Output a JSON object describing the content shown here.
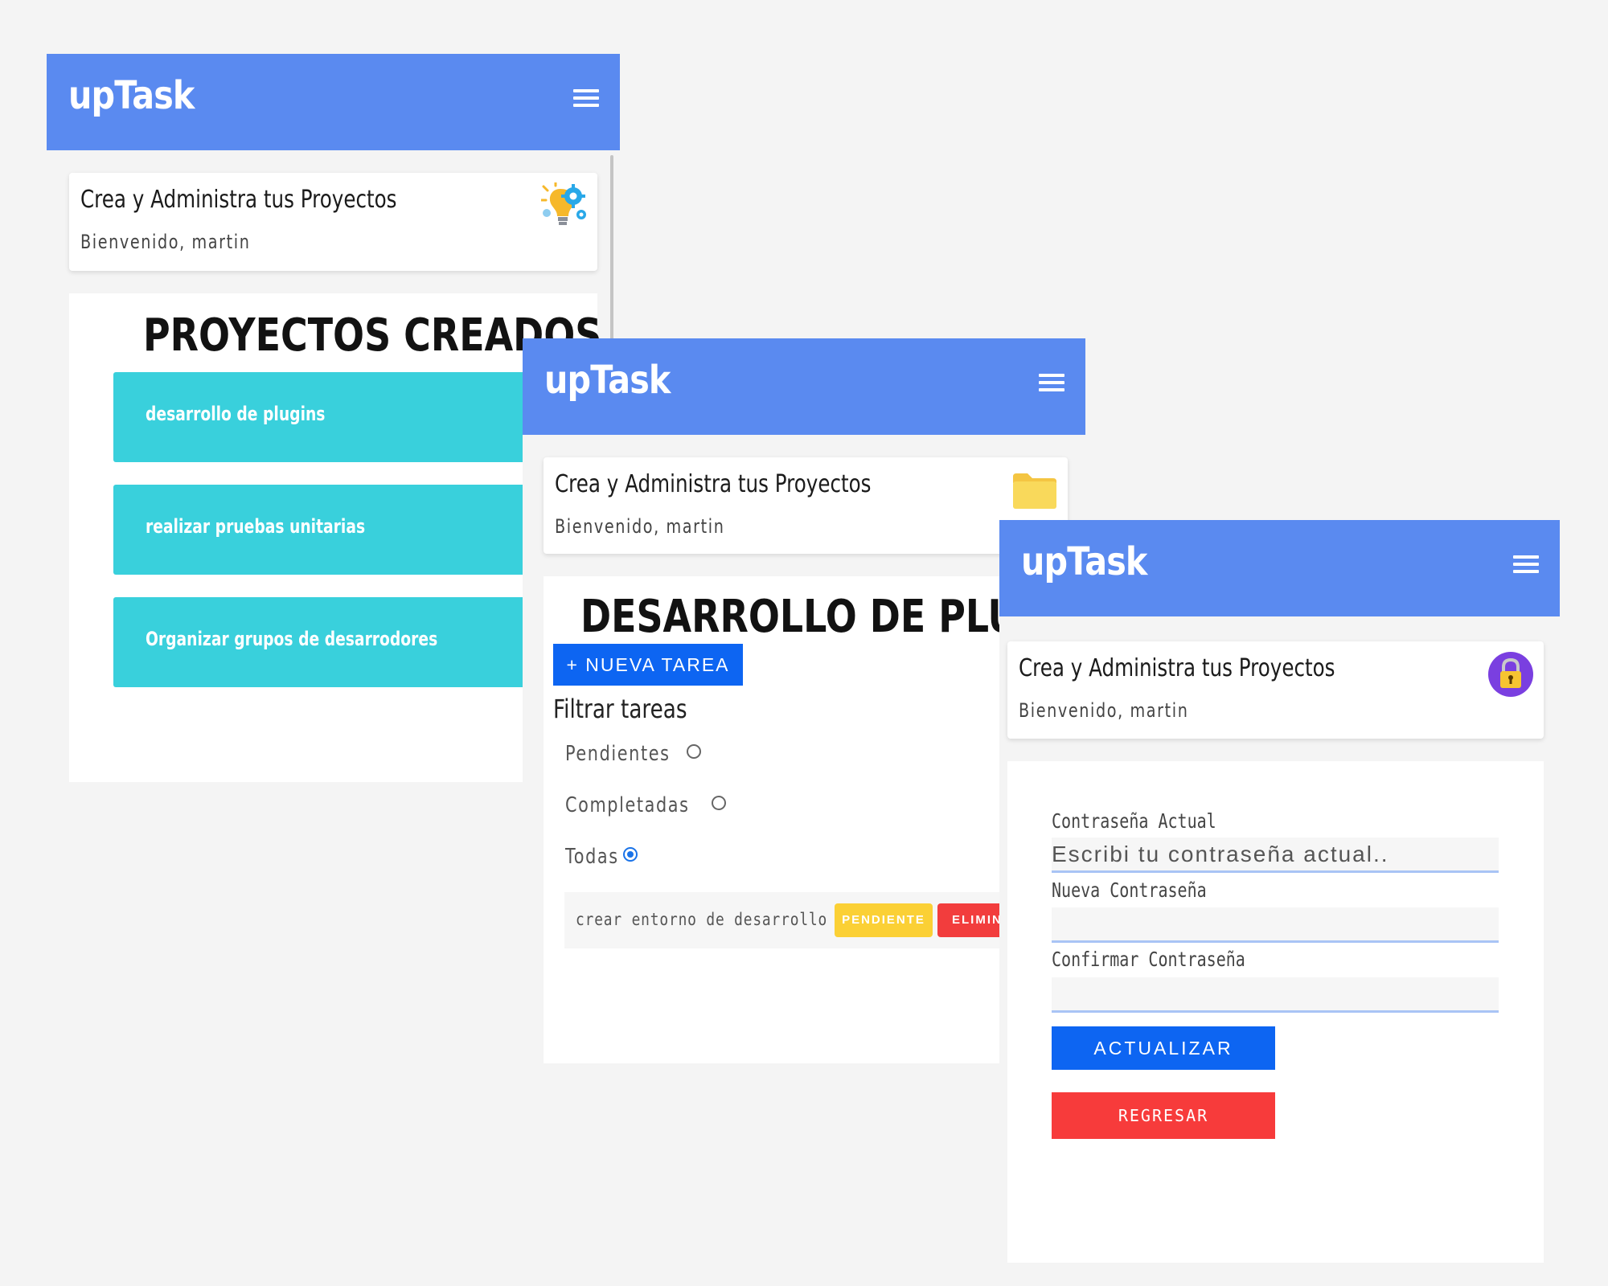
{
  "screens": {
    "projects": {
      "brand": "upTask",
      "welcome": {
        "title": "Crea y Administra tus Proyectos",
        "subtitle": "Bienvenido, martin"
      },
      "heading": "PROYECTOS CREADOS",
      "projects": [
        {
          "name": "desarrollo de plugins"
        },
        {
          "name": "realizar pruebas unitarias"
        },
        {
          "name": "Organizar grupos de desarrodores"
        }
      ],
      "card_icon": "lightbulb-gear-icon"
    },
    "project_detail": {
      "brand": "upTask",
      "welcome": {
        "title": "Crea y Administra tus Proyectos",
        "subtitle": "Bienvenido, martin"
      },
      "card_icon": "folder-icon",
      "heading": "DESARROLLO DE PLUGIN",
      "new_task_label": "+ NUEVA TAREA",
      "filter_title": "Filtrar tareas",
      "filters": [
        {
          "label": "Pendientes",
          "checked": false
        },
        {
          "label": "Completadas",
          "checked": false
        },
        {
          "label": "Todas",
          "checked": true
        }
      ],
      "tasks": [
        {
          "name": "crear entorno de desarrollo",
          "status_label": "PENDIENTE",
          "delete_label": "ELIMIN"
        }
      ]
    },
    "password": {
      "brand": "upTask",
      "welcome": {
        "title": "Crea y Administra tus Proyectos",
        "subtitle": "Bienvenido, martin"
      },
      "card_icon": "lock-icon",
      "fields": {
        "current_label": "Contraseña Actual",
        "current_placeholder": "Escribi tu contraseña actual..",
        "new_label": "Nueva Contraseña",
        "confirm_label": "Confirmar Contraseña"
      },
      "update_label": "ACTUALIZAR",
      "back_label": "REGRESAR"
    }
  },
  "colors": {
    "appbar": "#5a8af0",
    "project_tile": "#39d0dc",
    "primary_button": "#0d65f2",
    "pending_badge": "#fbd035",
    "danger": "#f23d3d"
  }
}
